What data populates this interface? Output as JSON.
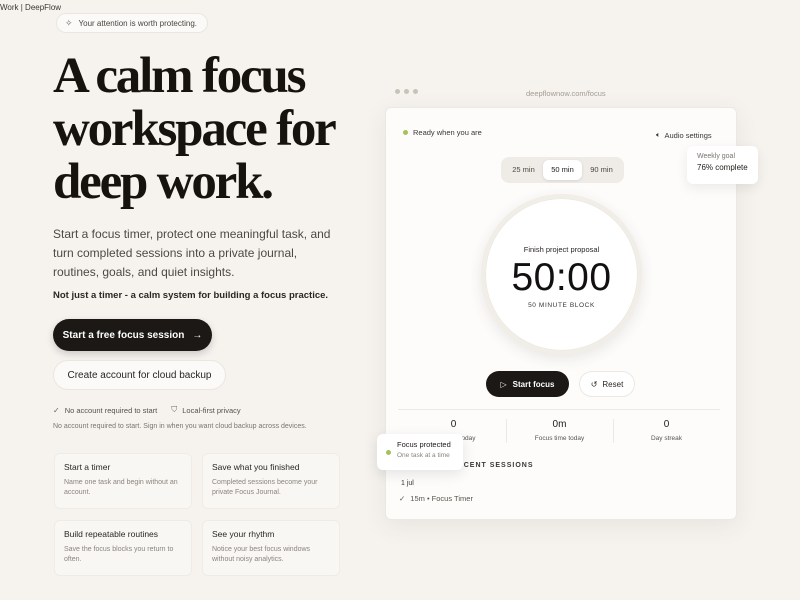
{
  "browser": {
    "tab_title": "Work | DeepFlow"
  },
  "hero": {
    "badge": "Your attention is worth protecting.",
    "headline_lines": [
      "A calm focus",
      "workspace for",
      "deep work."
    ],
    "subcopy": "Start a focus timer, protect one meaningful task, and turn completed sessions into a private journal, routines, goals, and quiet insights.",
    "tagline": "Not just a timer - a calm system for building a focus practice.",
    "primary_cta": "Start a free focus session",
    "secondary_cta": "Create account for cloud backup",
    "checks": [
      "No account required to start",
      "Local-first privacy"
    ],
    "fineprint": "No account required to start. Sign in when you want cloud backup across devices."
  },
  "features": [
    {
      "title": "Start a timer",
      "desc": "Name one task and begin without an account."
    },
    {
      "title": "Save what you finished",
      "desc": "Completed sessions become your private Focus Journal."
    },
    {
      "title": "Build repeatable routines",
      "desc": "Save the focus blocks you return to often."
    },
    {
      "title": "See your rhythm",
      "desc": "Notice your best focus windows without noisy analytics."
    }
  ],
  "app": {
    "url": "deepflownow.com/focus",
    "status": "Ready when you are",
    "audio": "Audio settings",
    "durations": [
      "25 min",
      "50 min",
      "90 min"
    ],
    "selected_duration": "50 min",
    "weekly_goal": {
      "label": "Weekly goal",
      "value": "76% complete"
    },
    "task": "Finish project proposal",
    "time": "50:00",
    "block_label": "50 MINUTE BLOCK",
    "start": "Start focus",
    "reset": "Reset",
    "stats": [
      {
        "value": "0",
        "label": "Sessions today"
      },
      {
        "value": "0m",
        "label": "Focus time today"
      },
      {
        "value": "0",
        "label": "Day streak"
      }
    ],
    "sessions_heading": "RECENT SESSIONS",
    "session_date": "1 jul",
    "session_entry": "15m • Focus Timer",
    "toast": {
      "title": "Focus protected",
      "subtitle": "One task at a time"
    }
  },
  "colors": {
    "accent": "#a4c258",
    "dark": "#1b1815",
    "background": "#f6f3ef"
  }
}
